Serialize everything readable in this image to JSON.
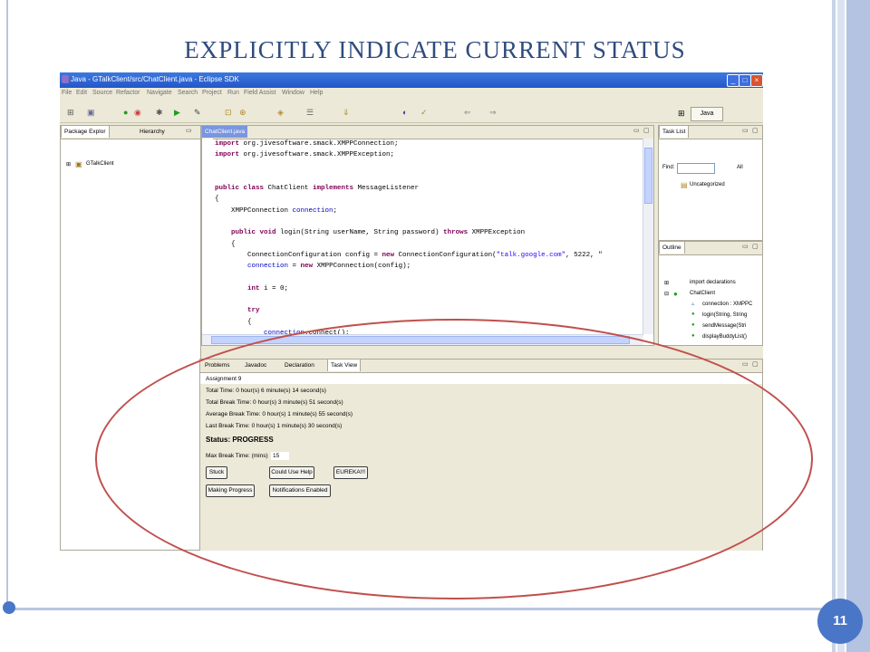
{
  "slide": {
    "title": "EXPLICITLY INDICATE CURRENT STATUS",
    "page_number": "11"
  },
  "window": {
    "title": "Java - GTalkClient/src/ChatClient.java - Eclipse SDK",
    "minimize": "_",
    "maximize": "□",
    "close": "×"
  },
  "menu": [
    "File",
    "Edit",
    "Source",
    "Refactor",
    "Navigate",
    "Search",
    "Project",
    "Run",
    "Field Assist",
    "Window",
    "Help"
  ],
  "toolbar": {
    "perspective_label": "Java",
    "icons": [
      "⊞",
      "▣",
      "●",
      "◉",
      "✱",
      "▶",
      "✎",
      "⊡",
      "⊕",
      "◈",
      "☰",
      "⇓",
      "◐",
      "✓",
      "⇐",
      "⇒"
    ]
  },
  "package_explorer": {
    "tab_label": "Package Explor",
    "tab2_label": "Hierarchy",
    "project": "GTalkClient"
  },
  "editor": {
    "tab_label": "ChatClient.java",
    "lines": [
      [
        [
          "kw",
          "import"
        ],
        [
          "t",
          " org.jivesoftware.smack.XMPPConnection;"
        ]
      ],
      [
        [
          "kw",
          "import"
        ],
        [
          "t",
          " org.jivesoftware.smack.XMPPException;"
        ]
      ],
      [
        [
          "t",
          ""
        ]
      ],
      [
        [
          "t",
          ""
        ]
      ],
      [
        [
          "kw",
          "public class"
        ],
        [
          "t",
          " ChatClient "
        ],
        [
          "kw",
          "implements"
        ],
        [
          "t",
          " MessageListener"
        ]
      ],
      [
        [
          "t",
          "{"
        ]
      ],
      [
        [
          "t",
          "    XMPPConnection "
        ],
        [
          "fld",
          "connection"
        ],
        [
          "t",
          ";"
        ]
      ],
      [
        [
          "t",
          ""
        ]
      ],
      [
        [
          "t",
          "    "
        ],
        [
          "kw",
          "public void"
        ],
        [
          "t",
          " login(String userName, String password) "
        ],
        [
          "kw",
          "throws"
        ],
        [
          "t",
          " XMPPException"
        ]
      ],
      [
        [
          "t",
          "    {"
        ]
      ],
      [
        [
          "t",
          "        ConnectionConfiguration config = "
        ],
        [
          "kw",
          "new"
        ],
        [
          "t",
          " ConnectionConfiguration("
        ],
        [
          "str",
          "\"talk.google.com\""
        ],
        [
          "t",
          ", 5222, \""
        ]
      ],
      [
        [
          "t",
          "        "
        ],
        [
          "fld",
          "connection"
        ],
        [
          "t",
          " = "
        ],
        [
          "kw",
          "new"
        ],
        [
          "t",
          " XMPPConnection(config);"
        ]
      ],
      [
        [
          "t",
          ""
        ]
      ],
      [
        [
          "t",
          "        "
        ],
        [
          "kw",
          "int"
        ],
        [
          "t",
          " i = 0;"
        ]
      ],
      [
        [
          "t",
          ""
        ]
      ],
      [
        [
          "t",
          "        "
        ],
        [
          "kw",
          "try"
        ]
      ],
      [
        [
          "t",
          "        {"
        ]
      ],
      [
        [
          "t",
          "            "
        ],
        [
          "fld",
          "connection"
        ],
        [
          "t",
          ".connect();"
        ]
      ]
    ]
  },
  "task_list": {
    "tab_label": "Task List",
    "find_label": "Find:",
    "all_label": "All",
    "category": "Uncategorized"
  },
  "outline": {
    "tab_label": "Outline",
    "items": [
      "import declarations",
      "ChatClient",
      "connection : XMPPC",
      "login(String, String",
      "sendMessage(Stri",
      "displayBuddyList()"
    ]
  },
  "bottom_tabs": [
    "Problems",
    "Javadoc",
    "Declaration",
    "Task View"
  ],
  "task_view": {
    "assignment": "Assignment 9",
    "total_time": "Total Time: 0 hour(s) 6 minute(s) 14 second(s)",
    "total_break_time": "Total Break Time: 0 hour(s) 3 minute(s) 51 second(s)",
    "average_break_time": "Average Break Time: 0 hour(s) 1 minute(s) 55 second(s)",
    "last_break_time": "Last Break Time: 0 hour(s) 1 minute(s) 30 second(s)",
    "status": "Status: PROGRESS",
    "max_break_label": "Max Break Time: (mins)",
    "max_break_value": "15",
    "buttons": {
      "stuck": "Stuck",
      "could_use_help": "Could Use Help",
      "eureka": "EUREKA!!!",
      "making_progress": "Making Progress",
      "notifications": "Notifications Enabled"
    }
  },
  "colors": {
    "title_blue": "#2f4c7e",
    "accent_blue": "#4a76c7",
    "annotation_red": "#c0504d",
    "eclipse_chrome": "#ece9d8"
  }
}
